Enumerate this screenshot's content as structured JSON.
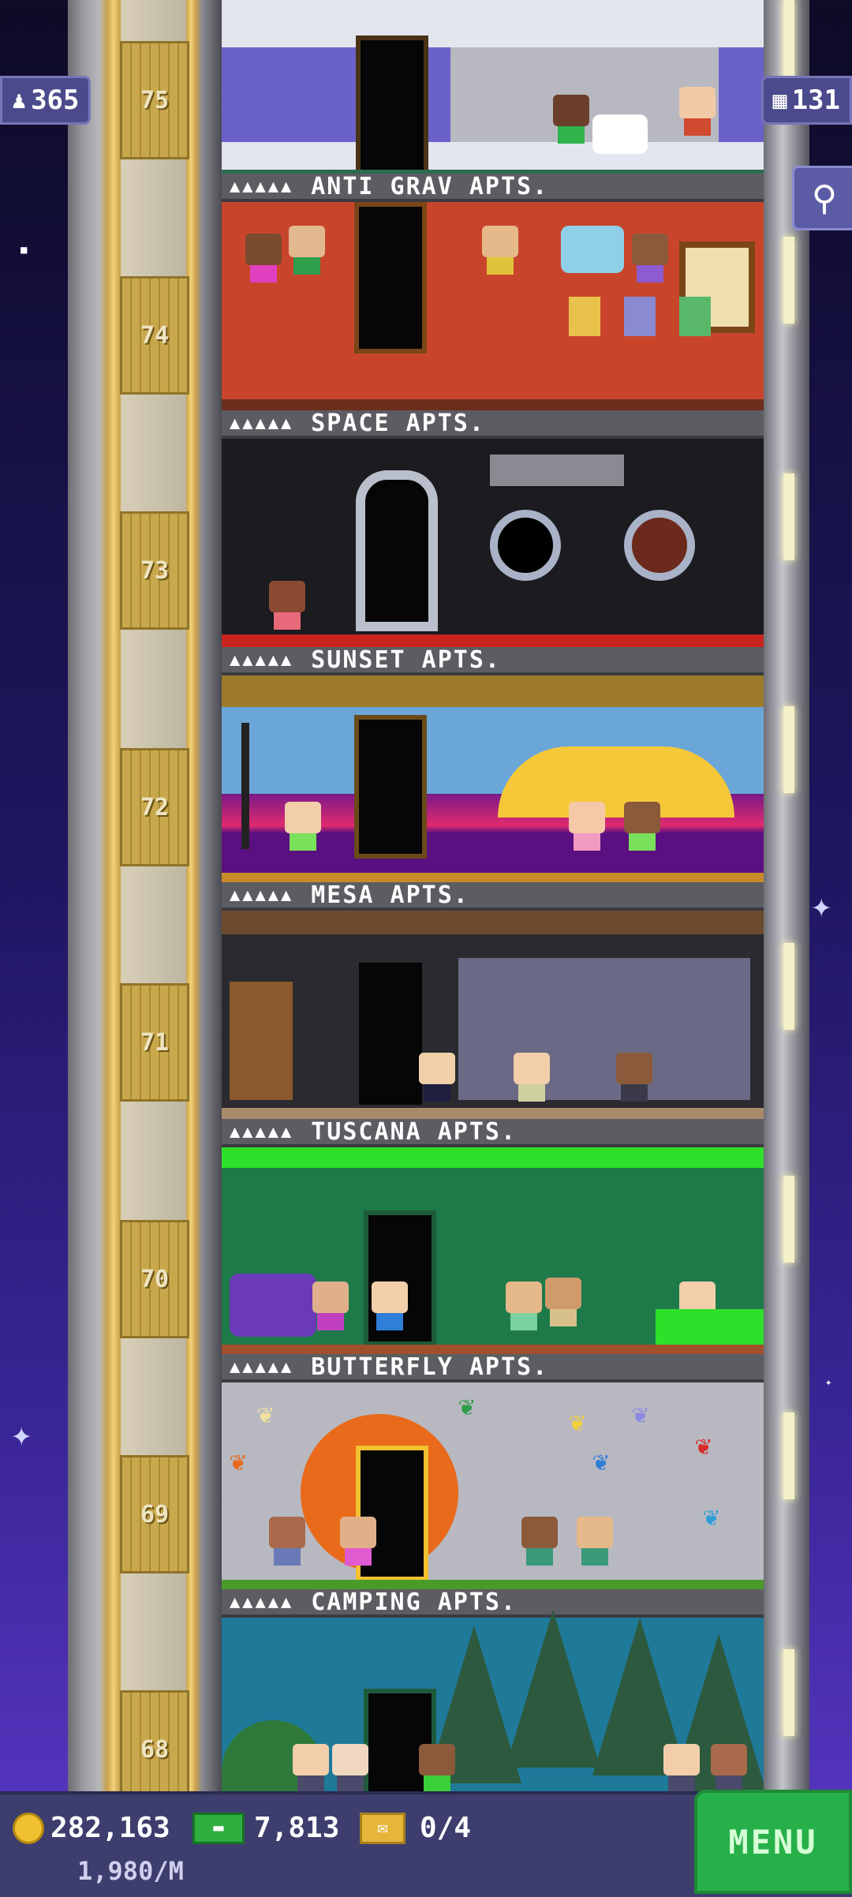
{
  "hud": {
    "population": "365",
    "population_icon": "person-icon",
    "floors": "131",
    "floors_icon": "building-icon",
    "search_icon": "magnifier-icon"
  },
  "floors": [
    {
      "number": "75",
      "name": "",
      "sign_dots": ""
    },
    {
      "number": "74",
      "name": "ANTI GRAV APTS.",
      "sign_dots": "▲▲▲▲▲"
    },
    {
      "number": "73",
      "name": "SPACE APTS.",
      "sign_dots": "▲▲▲▲▲"
    },
    {
      "number": "72",
      "name": "SUNSET APTS.",
      "sign_dots": "▲▲▲▲▲"
    },
    {
      "number": "71",
      "name": "MESA APTS.",
      "sign_dots": "▲▲▲▲▲"
    },
    {
      "number": "70",
      "name": "TUSCANA APTS.",
      "sign_dots": "▲▲▲▲▲"
    },
    {
      "number": "69",
      "name": "BUTTERFLY APTS.",
      "sign_dots": "▲▲▲▲▲"
    },
    {
      "number": "68",
      "name": "CAMPING APTS.",
      "sign_dots": "▲▲▲▲▲"
    }
  ],
  "bottom": {
    "coins": "282,163",
    "bux": "7,813",
    "tickets": "0/4",
    "rate": "1,980/M",
    "menu_label": "MENU"
  },
  "colors": {
    "sky_top": "#0d0b26",
    "sky_bottom": "#5a38c7",
    "menu_green": "#27b04a",
    "hud_panel": "#4a4a8c"
  }
}
